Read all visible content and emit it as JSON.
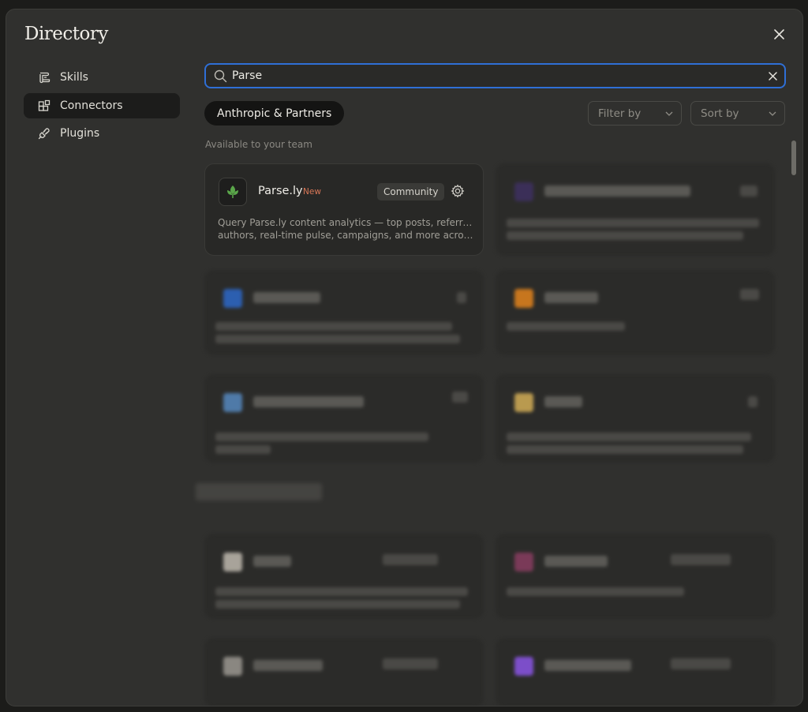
{
  "modal": {
    "title": "Directory"
  },
  "sidebar": {
    "items": [
      {
        "label": "Skills",
        "icon": "scroll-icon",
        "active": false
      },
      {
        "label": "Connectors",
        "icon": "blocks-icon",
        "active": true
      },
      {
        "label": "Plugins",
        "icon": "plug-icon",
        "active": false
      }
    ]
  },
  "search": {
    "value": "Parse"
  },
  "filters": {
    "chip_label": "Anthropic & Partners",
    "filter_by": "Filter by",
    "sort_by": "Sort by"
  },
  "section": {
    "label": "Available to your team"
  },
  "card": {
    "name": "Parse.ly",
    "tag": "New",
    "badge": "Community",
    "desc_line1": "Query Parse.ly content analytics — top posts, referrers,",
    "desc_line2": "authors, real-time pulse, campaigns, and more across your"
  },
  "colors": {
    "accent_focus": "#2f6fd6",
    "new_tag": "#d97757",
    "parsely_green": "#5aa64a"
  }
}
